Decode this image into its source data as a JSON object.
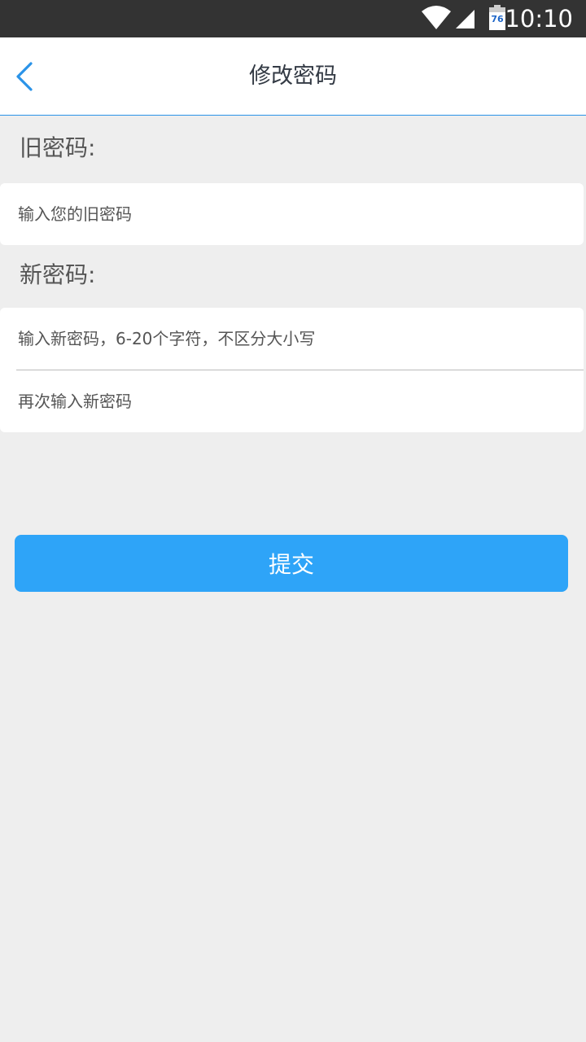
{
  "status_bar": {
    "battery_level": "76",
    "time": "10:10",
    "icons": [
      "wifi-icon",
      "signal-icon",
      "battery-icon"
    ]
  },
  "nav": {
    "title": "修改密码",
    "back_icon": "chevron-left-icon"
  },
  "form": {
    "old_password_label": "旧密码:",
    "old_password_placeholder": "输入您的旧密码",
    "new_password_label": "新密码:",
    "new_password_placeholder": "输入新密码，6-20个字符，不区分大小写",
    "confirm_password_placeholder": "再次输入新密码",
    "submit_label": "提交"
  },
  "colors": {
    "accent": "#2ea4f8",
    "background": "#eeeeee",
    "status_bar": "#333333",
    "back_icon": "#2a93e8"
  }
}
